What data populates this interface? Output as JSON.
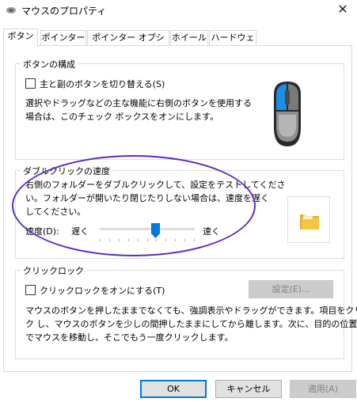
{
  "window": {
    "title": "マウスのプロパティ",
    "icons": {
      "app": "mouse-icon",
      "close": "close-icon"
    },
    "close_glyph": "✕"
  },
  "tabs": [
    {
      "label": "ボタン",
      "active": true
    },
    {
      "label": "ポインター",
      "active": false
    },
    {
      "label": "ポインター オプション",
      "active": false
    },
    {
      "label": "ホイール",
      "active": false
    },
    {
      "label": "ハードウェア",
      "active": false
    }
  ],
  "button_config": {
    "title": "ボタンの構成",
    "swap_checkbox_label": "主と副のボタンを切り替える(S)",
    "swap_checked": false,
    "description": "選択やドラッグなどの主な機能に右側のボタンを使用する\n場合は、このチェック ボックスをオンにします。",
    "illustration": "mouse-illustration-icon"
  },
  "double_click": {
    "title": "ダブルクリックの速度",
    "description": "右側のフォルダーをダブルクリックして、設定をテストしてくださ\nい。フォルダーが開いたり閉じたりしない場合は、速度を遅く\nしてください。",
    "speed_label": "速度(D):",
    "slow_label": "遅く",
    "fast_label": "速く",
    "speed_level": 0.6,
    "test_icon": "folder-icon"
  },
  "click_lock": {
    "title": "クリックロック",
    "checkbox_label": "クリックロックをオンにする(T)",
    "checked": false,
    "settings_button": "設定(E)...",
    "description": "マウスのボタンを押したままでなくても、強調表示やドラッグができます。項目をクリッ\nク し、マウスのボタンを少しの間押したままにしてから離します。次に、目的の位置ま\nでマウスを移動し、そこでもう一度クリックします。"
  },
  "footer": {
    "ok": "OK",
    "cancel": "キャンセル",
    "apply": "適用(A)"
  },
  "colors": {
    "accent": "#0078d7",
    "annotation": "#5b2dbf",
    "mouse_highlight": "#1a8fe3",
    "folder": "#f5c542"
  }
}
